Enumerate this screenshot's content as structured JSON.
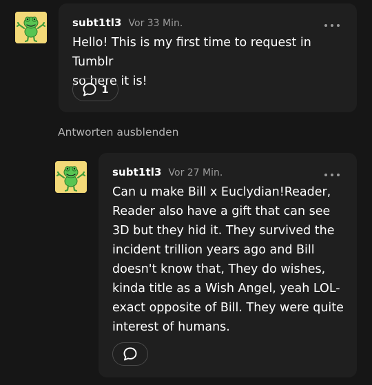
{
  "comments": [
    {
      "username": "subt1tl3",
      "time": "Vor 33 Min.",
      "lines": [
        "Hello! This is my first time to request in Tumblr",
        "so here it is!"
      ],
      "reply_count": "1",
      "avatar_icon": "green-frog-avatar-icon",
      "more_icon": "more-options-icon",
      "reply_icon": "speech-bubble-icon"
    },
    {
      "username": "subt1tl3",
      "time": "Vor 27 Min.",
      "lines": [
        "Can u make Bill x Euclydian!Reader,",
        "Reader also have a gift that can see",
        "3D but they hid it. They survived the",
        "incident trillion years ago and Bill",
        "doesn't know that, They do wishes,",
        "kinda title as a Wish Angel, yeah LOL-",
        "exact opposite of Bill. They were quite",
        "interest of humans."
      ],
      "reply_icon": "speech-bubble-icon"
    }
  ],
  "thread": {
    "hide_replies_label": "Antworten ausblenden"
  },
  "colors": {
    "background": "#161616",
    "card": "#1f1f1f",
    "avatar_bg": "#f3d978",
    "avatar_frog": "#58c552",
    "muted_text": "#9a9a9a"
  }
}
